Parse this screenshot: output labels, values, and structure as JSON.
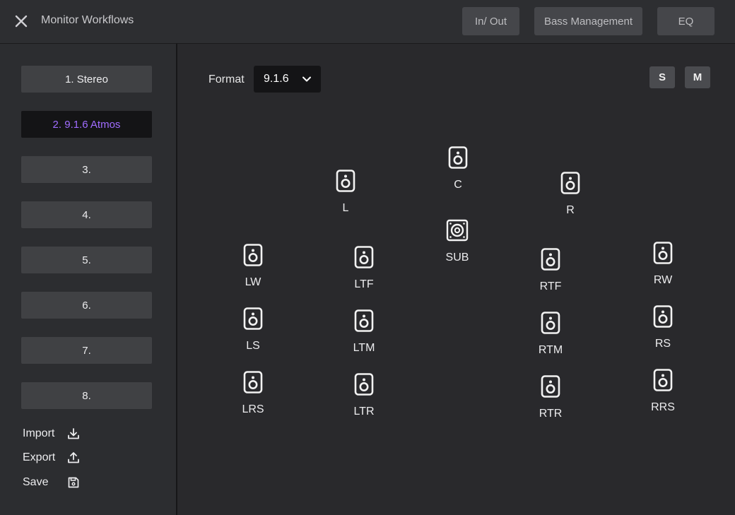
{
  "header": {
    "title": "Monitor Workflows",
    "buttons": {
      "in_out": "In/ Out",
      "bass_management": "Bass Management",
      "eq": "EQ"
    }
  },
  "sidebar": {
    "presets": [
      "1. Stereo",
      "2. 9.1.6 Atmos",
      "3.",
      "4.",
      "5.",
      "6.",
      "7.",
      "8."
    ],
    "active_preset": "2. 9.1.6 Atmos",
    "actions": {
      "import": "Import",
      "export": "Export",
      "save": "Save"
    }
  },
  "main": {
    "format_label": "Format",
    "format_value": "9.1.6",
    "solo_label": "S",
    "mute_label": "M",
    "speakers": {
      "L": "L",
      "C": "C",
      "R": "R",
      "SUB": "SUB",
      "LW": "LW",
      "LTF": "LTF",
      "RTF": "RTF",
      "RW": "RW",
      "LS": "LS",
      "LTM": "LTM",
      "RTM": "RTM",
      "RS": "RS",
      "LRS": "LRS",
      "LTR": "LTR",
      "RTR": "RTR",
      "RRS": "RRS"
    }
  },
  "colors": {
    "accent": "#a06cff",
    "background": "#29292c",
    "button": "#404144"
  }
}
